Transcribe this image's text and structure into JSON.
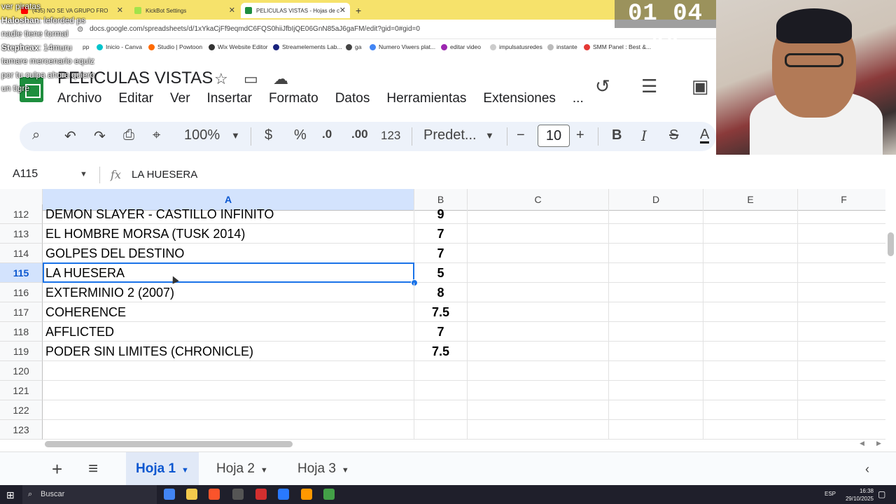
{
  "browser": {
    "tabs": [
      {
        "label": "(435) NO SE VA GRUPO FRO",
        "color": "#ff0000"
      },
      {
        "label": "KickBot Settings",
        "color": "#a2e34a"
      },
      {
        "label": "PELICULAS VISTAS - Hojas de c",
        "color": "#1e8e3e"
      }
    ],
    "new_tab": "+",
    "url": "docs.google.com/spreadsheets/d/1xYkaCjFf9eqmdC6FQS0hiiJfbIjQE06GnN85aJ6gaFM/edit?gid=0#gid=0",
    "bookmarks": [
      {
        "label": "pp",
        "color": "#888888"
      },
      {
        "label": "Inicio - Canva",
        "color": "#00c4cc"
      },
      {
        "label": "Studio | Powtoon",
        "color": "#ff6a00"
      },
      {
        "label": "Wix Website Editor",
        "color": "#333333"
      },
      {
        "label": "Streamelements Lab...",
        "color": "#1a237e"
      },
      {
        "label": "ga",
        "color": "#444444"
      },
      {
        "label": "Numero Viwers plat...",
        "color": "#4285f4"
      },
      {
        "label": "editar video",
        "color": "#9c27b0"
      },
      {
        "label": "impulsatusredes",
        "color": "#cccccc"
      },
      {
        "label": "instante",
        "color": "#bbbbbb"
      },
      {
        "label": "SMM Panel : Best &...",
        "color": "#e53935"
      }
    ]
  },
  "doc": {
    "title": "PELICULAS VISTAS",
    "menu": [
      "Archivo",
      "Editar",
      "Ver",
      "Insertar",
      "Formato",
      "Datos",
      "Herramientas",
      "Extensiones",
      "..."
    ]
  },
  "toolbar": {
    "zoom": "100%",
    "currency": "$",
    "percent": "%",
    "dec_less": ".0",
    "dec_more": ".00",
    "number_format": "123",
    "font": "Predet...",
    "font_size": "10",
    "bold": "B",
    "italic": "I",
    "text_color": "A"
  },
  "formula_bar": {
    "name_box": "A115",
    "fx": "fx",
    "value": "LA HUESERA"
  },
  "grid": {
    "columns": [
      "A",
      "B",
      "C",
      "D",
      "E",
      "F"
    ],
    "selected_row": "115",
    "rows": [
      {
        "num": "112",
        "a": "DEMON SLAYER - CASTILLO INFINITO",
        "b": "9"
      },
      {
        "num": "113",
        "a": "EL HOMBRE MORSA (TUSK 2014)",
        "b": "7"
      },
      {
        "num": "114",
        "a": "GOLPES DEL DESTINO",
        "b": "7"
      },
      {
        "num": "115",
        "a": "LA HUESERA",
        "b": "5"
      },
      {
        "num": "116",
        "a": "EXTERMINIO 2 (2007)",
        "b": "8"
      },
      {
        "num": "117",
        "a": "COHERENCE",
        "b": "7.5"
      },
      {
        "num": "118",
        "a": "AFFLICTED",
        "b": "7"
      },
      {
        "num": "119",
        "a": "PODER SIN LIMITES (CHRONICLE)",
        "b": "7.5"
      },
      {
        "num": "120",
        "a": "",
        "b": ""
      },
      {
        "num": "121",
        "a": "",
        "b": ""
      },
      {
        "num": "122",
        "a": "",
        "b": ""
      },
      {
        "num": "123",
        "a": "",
        "b": ""
      }
    ]
  },
  "sheets": {
    "add": "+",
    "list": "≡",
    "tabs": [
      "Hoja 1",
      "Hoja 2",
      "Hoja 3"
    ],
    "active": "Hoja 1"
  },
  "taskbar": {
    "search": "Buscar",
    "lang": "ESP",
    "time": "16:38",
    "date": "29/10/2025"
  },
  "overlay": {
    "timer": "01 04 44",
    "chat": [
      {
        "author": "",
        "text": "ver piratas"
      },
      {
        "author": "Haloshan",
        "text": ": leforded ps"
      },
      {
        "author": "",
        "text": "nadie tiene formal"
      },
      {
        "author": "Stephcax",
        "text": ": 14muru"
      },
      {
        "author": "",
        "text": "tamare mercenario equiz"
      },
      {
        "author": "",
        "text": "por tu culpa ahora quiero"
      },
      {
        "author": "",
        "text": "un tigre"
      }
    ]
  }
}
